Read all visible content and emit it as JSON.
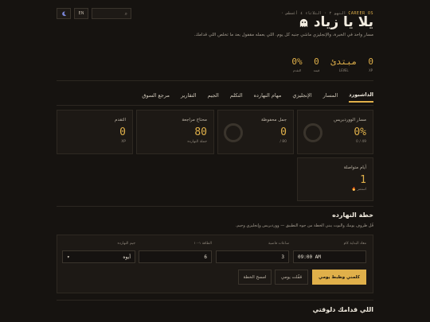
{
  "header": {
    "crumb_prefix": "CAREER OS",
    "crumb_rest": "· النهو ٢ · الثلاثاء ٤ أغسطس",
    "lang_btn": "EN",
    "theme_icon": "moon-icon",
    "search_icon": "search-icon",
    "title": "يلا يا زياد",
    "title_icon": "ghost-icon",
    "subtitle": "مسار واحد في الخبرة، والإنجليزي ماشي جنبه كل يوم. اللي بعمله مقفول بعد ما تخلص اللي قدامك."
  },
  "stats": [
    {
      "value": "0",
      "label": "XP"
    },
    {
      "value": "مبتدئ",
      "label": "LEVEL"
    },
    {
      "value": "0",
      "label": "قيمة"
    },
    {
      "value": "0%",
      "label": "التقدم"
    }
  ],
  "tabs": [
    {
      "label": "الداشبورد",
      "active": true
    },
    {
      "label": "المسار"
    },
    {
      "label": "الإنجليزي"
    },
    {
      "label": "مهام النهارده"
    },
    {
      "label": "التكلم"
    },
    {
      "label": "الجيم"
    },
    {
      "label": "التقارير"
    },
    {
      "label": "مرجع السوق"
    }
  ],
  "cards": [
    {
      "label": "مسار الووردبريس",
      "value": "0%",
      "sub": "0 / 49"
    },
    {
      "label": "جمل محفوظة",
      "value": "0",
      "sub": "/ 80"
    },
    {
      "label": "محتاج مراجعة",
      "value": "80",
      "sub": "جملة النهارده"
    },
    {
      "label": "التقدم",
      "value": "0",
      "sub": "XP"
    },
    {
      "label": "أيام متواصلة",
      "value": "1",
      "sub": "🔥 استمر"
    }
  ],
  "plan": {
    "title": "خطة النهارده",
    "desc": "قُل ظروف يومك والبوت يبني الخطة من جوه التطبيق — ووردبريس وإنجليزي وجيم.",
    "labels": {
      "start": "معاد البداية كام",
      "hours": "ساعات فاضية",
      "energy": "الطاقة ١-١٠",
      "gym": "جيم النهارده"
    },
    "values": {
      "start": "09:00 AM",
      "hours": "3",
      "energy": "6",
      "gym": "أيوه"
    },
    "buttons": {
      "primary": "كلمني وظبط يومي",
      "secondary": "قفّلت يومي",
      "tertiary": "امسح الخطة"
    }
  },
  "next": {
    "title": "اللي قدامك دلوقتي"
  }
}
